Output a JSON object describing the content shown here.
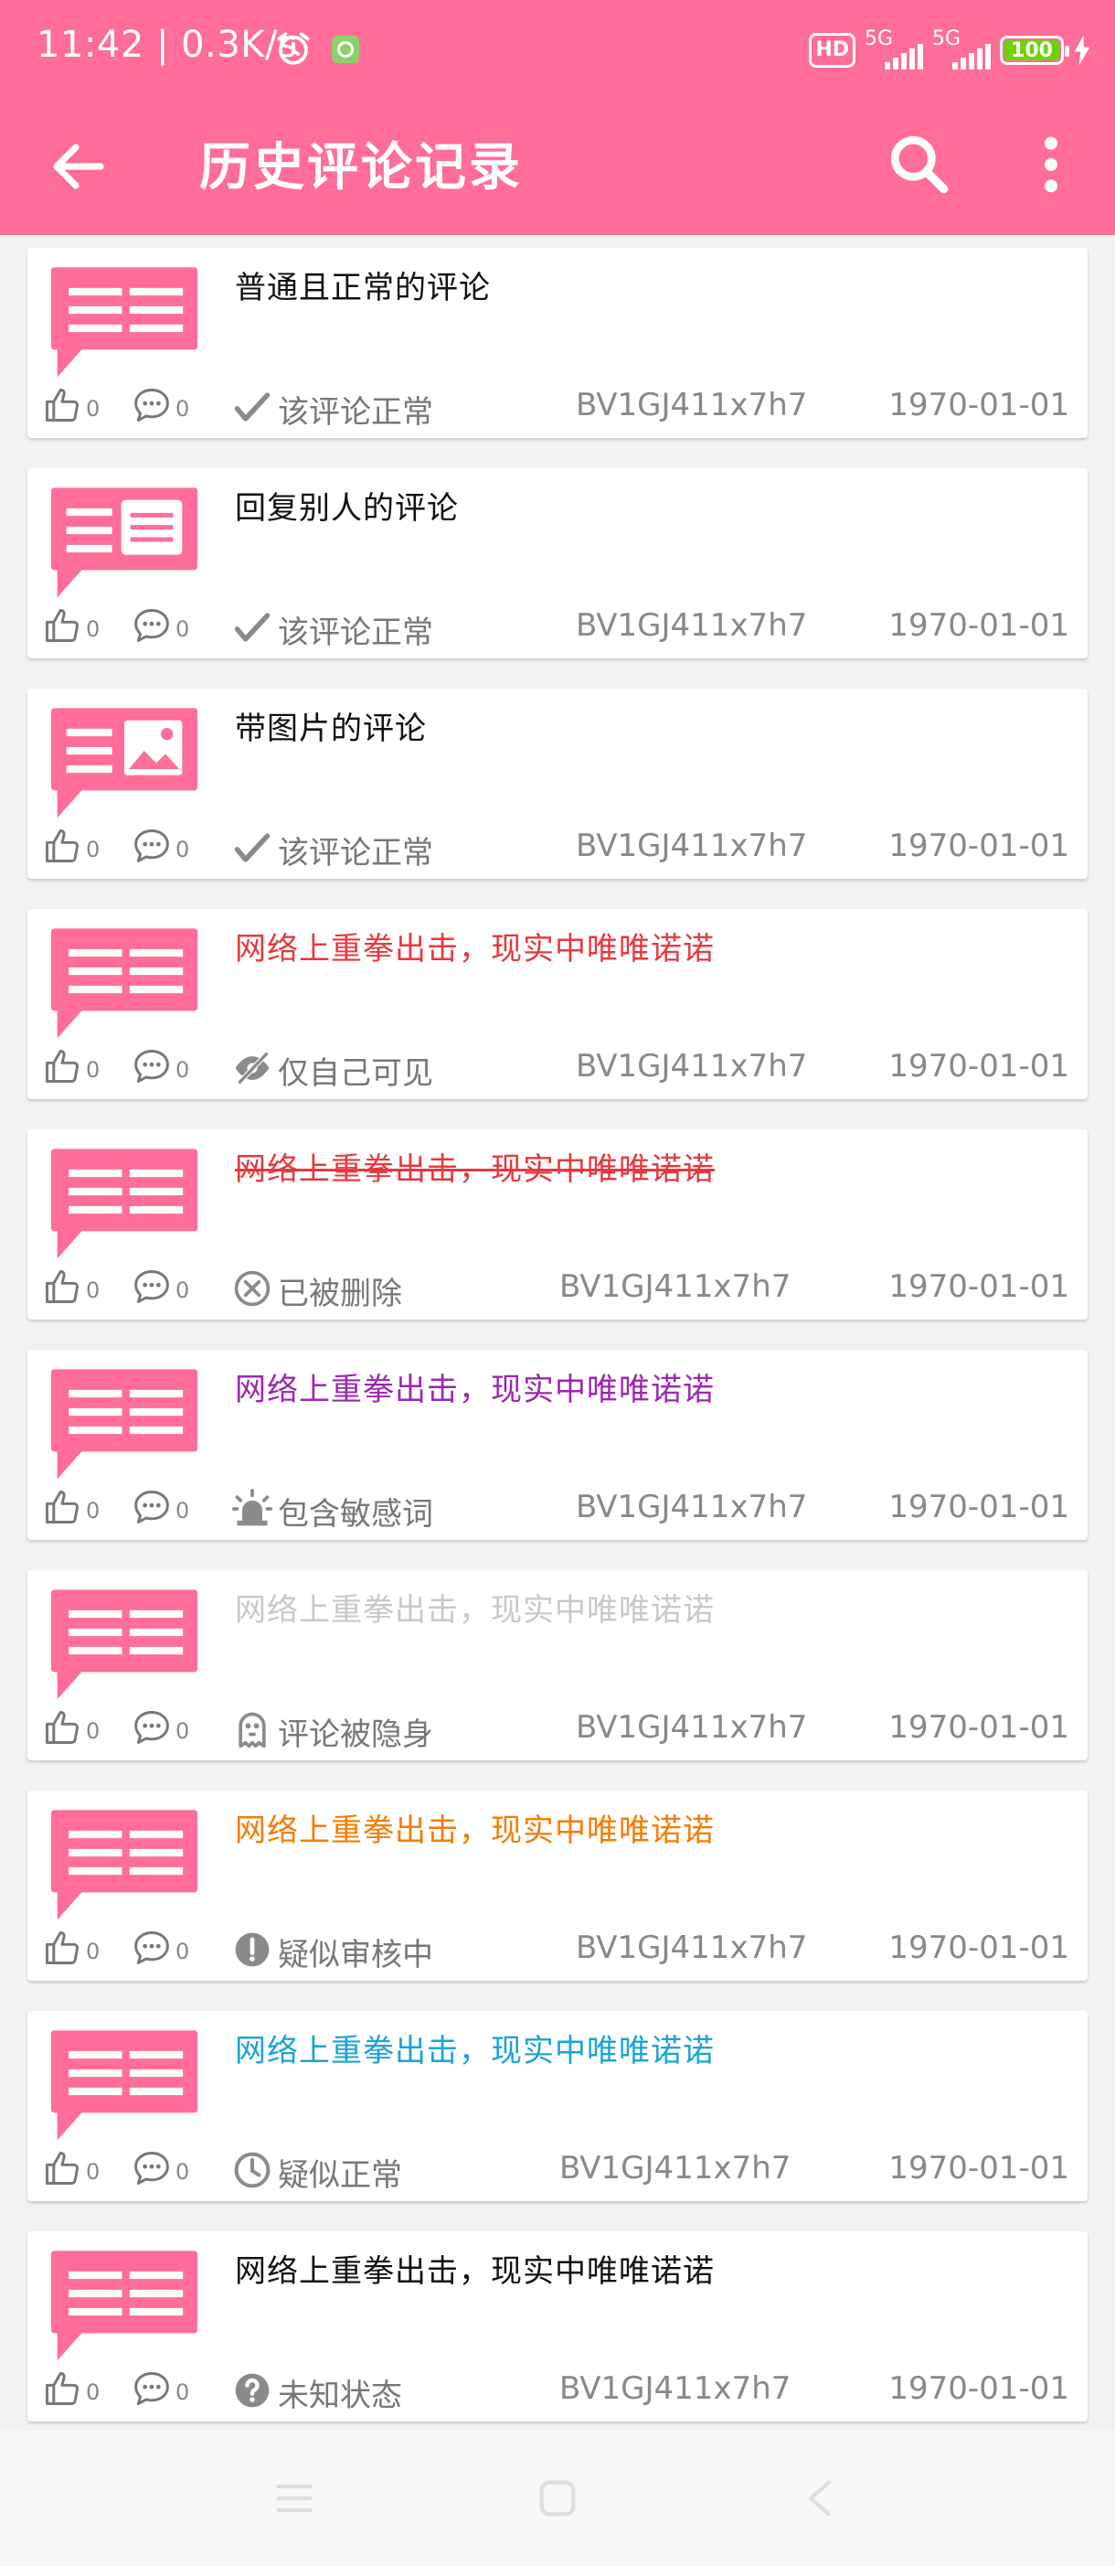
{
  "status_bar": {
    "time": "11:42 | 0.3K/s",
    "hd": "HD",
    "sim1": "5G",
    "sim2": "5G",
    "battery": "100"
  },
  "toolbar": {
    "title": "历史评论记录",
    "back_icon": "arrow-left-icon",
    "search_icon": "search-icon",
    "more_icon": "more-vertical-icon"
  },
  "colors": {
    "primary": "#ff6d98",
    "normal_text": "#111111",
    "red": "#e8383d",
    "purple": "#9c27b0",
    "grey": "#c8c8c8",
    "orange": "#f57c00",
    "blue": "#1aa3d8"
  },
  "comments": [
    {
      "thumb": "list",
      "text": "普通且正常的评论",
      "color": "#111111",
      "strike": false,
      "likes": "0",
      "replies": "0",
      "status_icon": "check",
      "status": "该评论正常",
      "bv": "BV1GJ411x7h7",
      "date": "1970-01-01"
    },
    {
      "thumb": "reply",
      "text": "回复别人的评论",
      "color": "#111111",
      "strike": false,
      "likes": "0",
      "replies": "0",
      "status_icon": "check",
      "status": "该评论正常",
      "bv": "BV1GJ411x7h7",
      "date": "1970-01-01"
    },
    {
      "thumb": "image",
      "text": "带图片的评论",
      "color": "#111111",
      "strike": false,
      "likes": "0",
      "replies": "0",
      "status_icon": "check",
      "status": "该评论正常",
      "bv": "BV1GJ411x7h7",
      "date": "1970-01-01"
    },
    {
      "thumb": "list",
      "text": "网络上重拳出击，现实中唯唯诺诺",
      "color": "#e8383d",
      "strike": false,
      "likes": "0",
      "replies": "0",
      "status_icon": "eye-off",
      "status": "仅自己可见",
      "bv": "BV1GJ411x7h7",
      "date": "1970-01-01"
    },
    {
      "thumb": "list",
      "text": "网络上重拳出击，现实中唯唯诺诺",
      "color": "#e8383d",
      "strike": true,
      "likes": "0",
      "replies": "0",
      "status_icon": "x-circle",
      "status": "已被删除",
      "bv": "BV1GJ411x7h7",
      "date": "1970-01-01"
    },
    {
      "thumb": "list",
      "text": "网络上重拳出击，现实中唯唯诺诺",
      "color": "#9c27b0",
      "strike": false,
      "likes": "0",
      "replies": "0",
      "status_icon": "siren",
      "status": "包含敏感词",
      "bv": "BV1GJ411x7h7",
      "date": "1970-01-01"
    },
    {
      "thumb": "list",
      "text": "网络上重拳出击，现实中唯唯诺诺",
      "color": "#c8c8c8",
      "strike": false,
      "likes": "0",
      "replies": "0",
      "status_icon": "ghost",
      "status": "评论被隐身",
      "bv": "BV1GJ411x7h7",
      "date": "1970-01-01"
    },
    {
      "thumb": "list",
      "text": "网络上重拳出击，现实中唯唯诺诺",
      "color": "#f57c00",
      "strike": false,
      "likes": "0",
      "replies": "0",
      "status_icon": "exclamation",
      "status": "疑似审核中",
      "bv": "BV1GJ411x7h7",
      "date": "1970-01-01"
    },
    {
      "thumb": "list",
      "text": "网络上重拳出击，现实中唯唯诺诺",
      "color": "#1aa3d8",
      "strike": false,
      "likes": "0",
      "replies": "0",
      "status_icon": "clock",
      "status": "疑似正常",
      "bv": "BV1GJ411x7h7",
      "date": "1970-01-01"
    },
    {
      "thumb": "list",
      "text": "网络上重拳出击，现实中唯唯诺诺",
      "color": "#111111",
      "strike": false,
      "likes": "0",
      "replies": "0",
      "status_icon": "question",
      "status": "未知状态",
      "bv": "BV1GJ411x7h7",
      "date": "1970-01-01"
    }
  ],
  "navbar": {
    "menu_icon": "menu-icon",
    "home_icon": "home-square-icon",
    "back_icon": "back-triangle-icon"
  }
}
